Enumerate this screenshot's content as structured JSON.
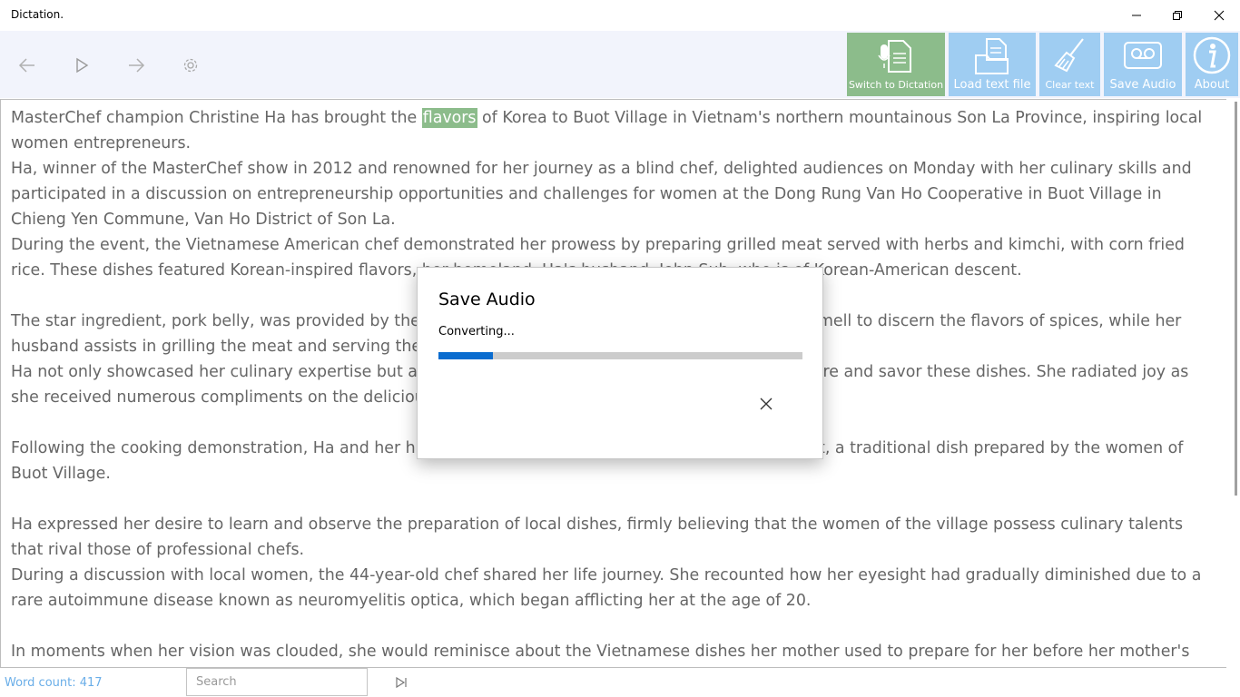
{
  "window": {
    "title": "Dictation."
  },
  "toolbar": {
    "buttons": [
      {
        "label": "Switch to Dictation",
        "icon": "microphone-document-icon"
      },
      {
        "label": "Load text file",
        "icon": "folder-document-icon"
      },
      {
        "label": "Clear text",
        "icon": "broom-icon"
      },
      {
        "label": "Save Audio",
        "icon": "cassette-tape-icon"
      },
      {
        "label": "About",
        "icon": "info-icon"
      }
    ],
    "nav_icons": [
      "back-arrow-icon",
      "play-icon",
      "forward-arrow-icon",
      "settings-gear-icon"
    ]
  },
  "document": {
    "p1_before": "MasterChef champion Christine Ha has brought the ",
    "p1_highlight": "flavors",
    "p1_after": " of Korea to Buot Village in Vietnam's northern mountainous Son La Province, inspiring local women entrepreneurs.",
    "p2": "Ha, winner of the MasterChef show in 2012 and renowned for her journey as a blind chef, delighted audiences on Monday with her culinary skills and participated in a discussion on entrepreneurship opportunities and challenges for women at the Dong Rung Van Ho Cooperative in Buot Village in Chieng Yen Commune, Van Ho District of Son La.",
    "p3": "During the event, the Vietnamese American chef demonstrated her prowess by preparing grilled meat served with herbs and kimchi, with corn fried rice. These dishes featured Korean-inspired flavors, her homeland. Ha's husband, John Suh, who is of Korean-American descent.",
    "p4": "The star ingredient, pork belly, was provided by the cooperative. Ha relies on her sense of taste and smell to discern the flavors of spices, while her husband assists in grilling the meat and serving the dishes.",
    "p5": "Ha not only showcased her culinary expertise but also instructed the women on how to properly prepare and savor these dishes. She radiated joy as she received numerous compliments on the delicious dishes.",
    "p6": "Following the cooking demonstration, Ha and her husband tasted steamed sticky rice with sesame salt, a traditional dish prepared by the women of Buot Village.",
    "p7": "Ha expressed her desire to learn and observe the preparation of local dishes, firmly believing that the women of the village possess culinary talents that rival those of professional chefs.",
    "p8": "During a discussion with local women, the 44-year-old chef shared her life journey. She recounted how her eyesight had gradually diminished due to a rare autoimmune disease known as neuromyelitis optica, which began afflicting her at the age of 20.",
    "p9": "In moments when her vision was clouded, she would reminisce about the Vietnamese dishes her mother used to prepare for her before her mother's"
  },
  "dialog": {
    "title": "Save Audio",
    "status": "Converting...",
    "progress": 0.15
  },
  "statusbar": {
    "word_count": "Word count: 417",
    "search_placeholder": "Search"
  },
  "colors": {
    "accent_blue": "#9fcdf2",
    "active_green": "#8cbc8b",
    "progress_blue": "#0a6ccf"
  }
}
